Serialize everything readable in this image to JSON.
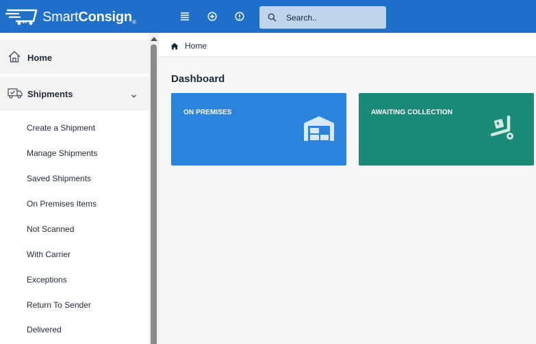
{
  "app": {
    "name_regular": "Smart",
    "name_bold": "Consign",
    "name_mark": "®"
  },
  "topbar": {
    "icons": [
      "menu-icon",
      "add-circle-icon",
      "alert-circle-icon"
    ]
  },
  "search": {
    "placeholder": "Search.."
  },
  "sidebar": {
    "home_label": "Home",
    "shipments_label": "Shipments",
    "shipment_items": [
      "Create a Shipment",
      "Manage Shipments",
      "Saved Shipments",
      "On Premises Items",
      "Not Scanned",
      "With Carrier",
      "Exceptions",
      "Return To Sender",
      "Delivered"
    ]
  },
  "breadcrumb": {
    "label": "Home"
  },
  "main": {
    "title": "Dashboard",
    "cards": [
      {
        "label": "ON PREMISES",
        "color": "#2b84db",
        "icon": "warehouse-icon"
      },
      {
        "label": "AWAITING COLLECTION",
        "color": "#1b8a77",
        "icon": "hand-truck-icon"
      }
    ]
  },
  "colors": {
    "topbar": "#1e70c8",
    "search_bg": "#bdd6ee"
  }
}
